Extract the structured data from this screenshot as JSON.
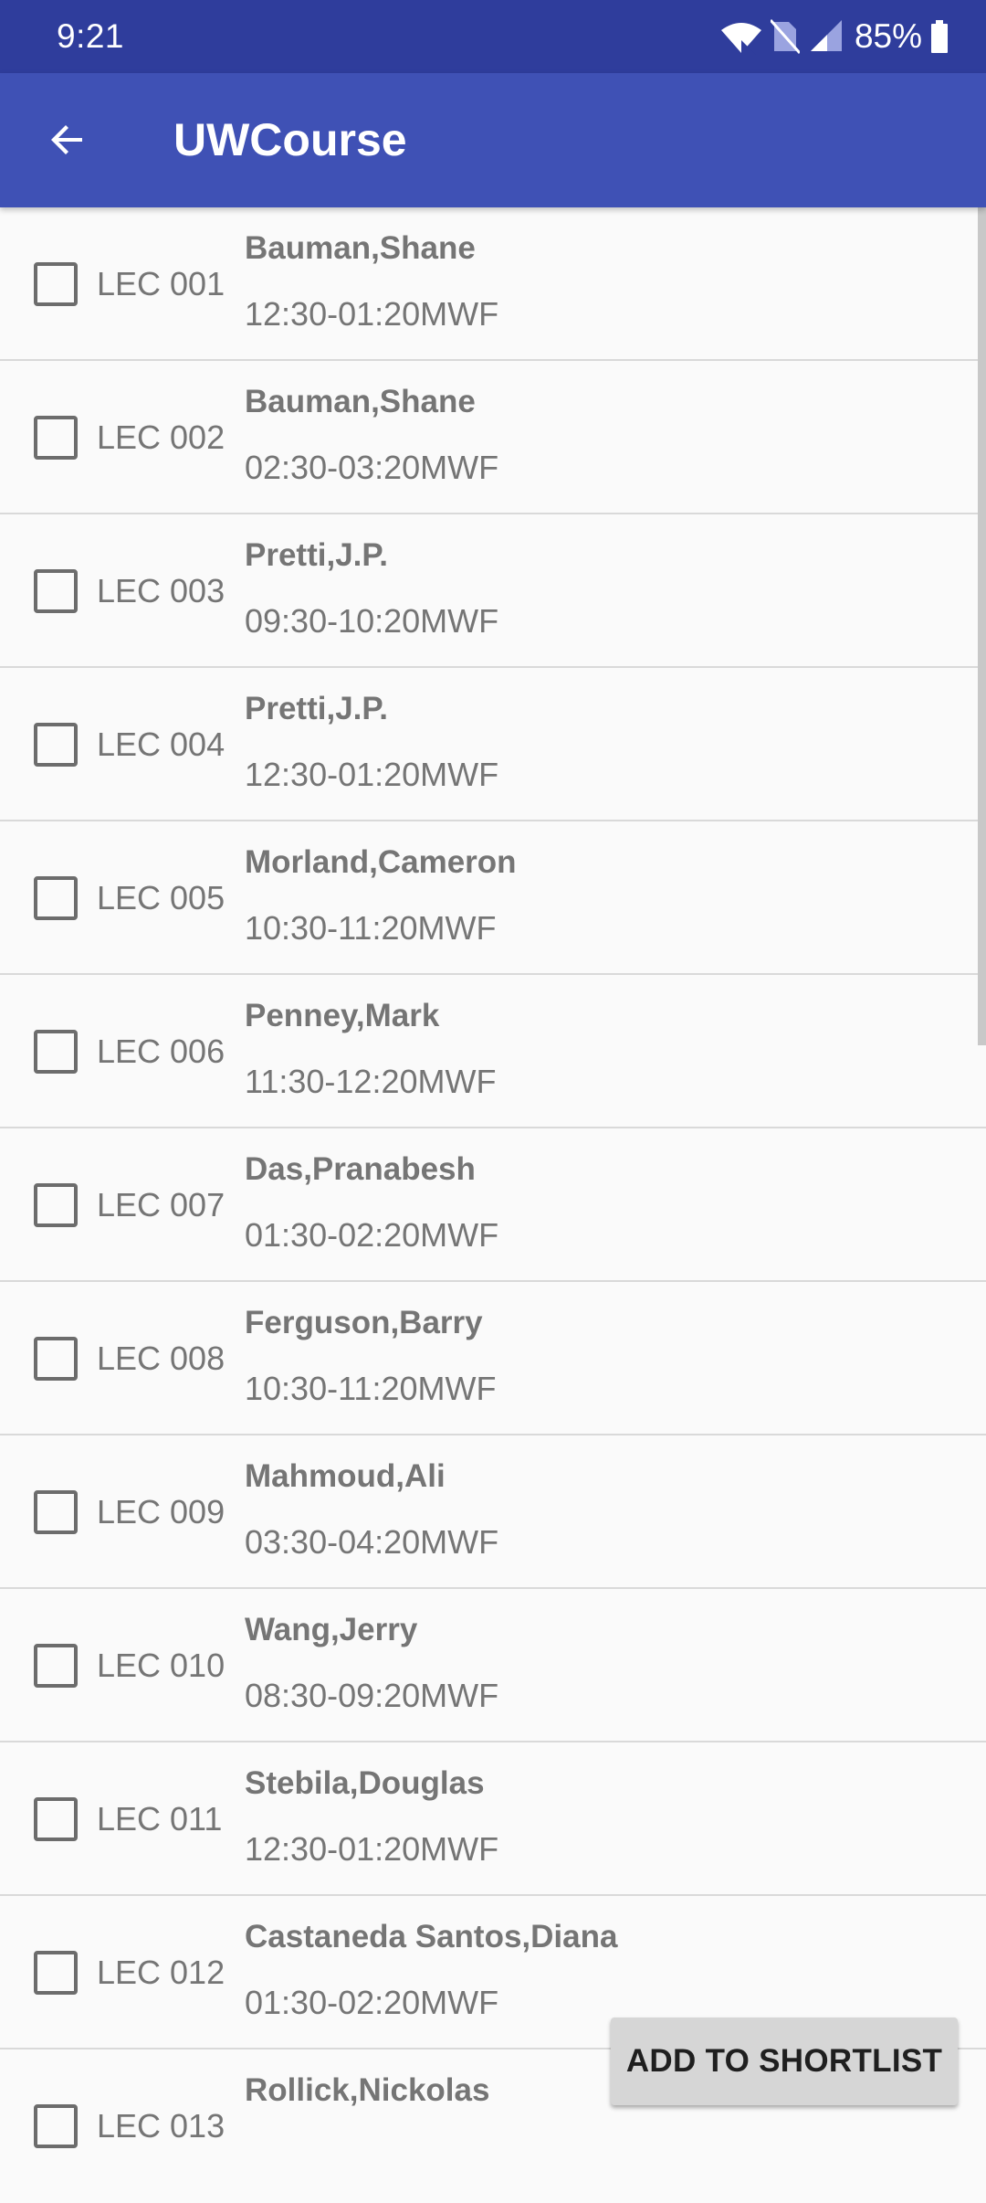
{
  "status_bar": {
    "time": "9:21",
    "battery_percent": "85%",
    "icons": [
      "wifi-icon",
      "no-sim-icon",
      "cell-signal-icon",
      "battery-icon"
    ]
  },
  "app_bar": {
    "title": "UWCourse",
    "back_icon": "arrow-back-icon"
  },
  "sections": [
    {
      "section": "LEC 001",
      "instructor": "Bauman,Shane",
      "time": "12:30-01:20MWF",
      "checked": false
    },
    {
      "section": "LEC 002",
      "instructor": "Bauman,Shane",
      "time": "02:30-03:20MWF",
      "checked": false
    },
    {
      "section": "LEC 003",
      "instructor": "Pretti,J.P.",
      "time": "09:30-10:20MWF",
      "checked": false
    },
    {
      "section": "LEC 004",
      "instructor": "Pretti,J.P.",
      "time": "12:30-01:20MWF",
      "checked": false
    },
    {
      "section": "LEC 005",
      "instructor": "Morland,Cameron",
      "time": "10:30-11:20MWF",
      "checked": false
    },
    {
      "section": "LEC 006",
      "instructor": "Penney,Mark",
      "time": "11:30-12:20MWF",
      "checked": false
    },
    {
      "section": "LEC 007",
      "instructor": "Das,Pranabesh",
      "time": "01:30-02:20MWF",
      "checked": false
    },
    {
      "section": "LEC 008",
      "instructor": "Ferguson,Barry",
      "time": "10:30-11:20MWF",
      "checked": false
    },
    {
      "section": "LEC 009",
      "instructor": "Mahmoud,Ali",
      "time": "03:30-04:20MWF",
      "checked": false
    },
    {
      "section": "LEC 010",
      "instructor": "Wang,Jerry",
      "time": "08:30-09:20MWF",
      "checked": false
    },
    {
      "section": "LEC 011",
      "instructor": "Stebila,Douglas",
      "time": "12:30-01:20MWF",
      "checked": false
    },
    {
      "section": "LEC 012",
      "instructor": "Castaneda Santos,Diana",
      "time": "01:30-02:20MWF",
      "checked": false
    },
    {
      "section": "LEC 013",
      "instructor": "Rollick,Nickolas",
      "time": "",
      "checked": false
    }
  ],
  "actions": {
    "add_to_shortlist": "ADD TO SHORTLIST"
  },
  "colors": {
    "status_bar": "#2f3d9c",
    "app_bar": "#3f51b5",
    "background": "#fafafa",
    "text_secondary": "#757575",
    "divider": "#d9d9d9",
    "button": "#d6d6d6"
  }
}
